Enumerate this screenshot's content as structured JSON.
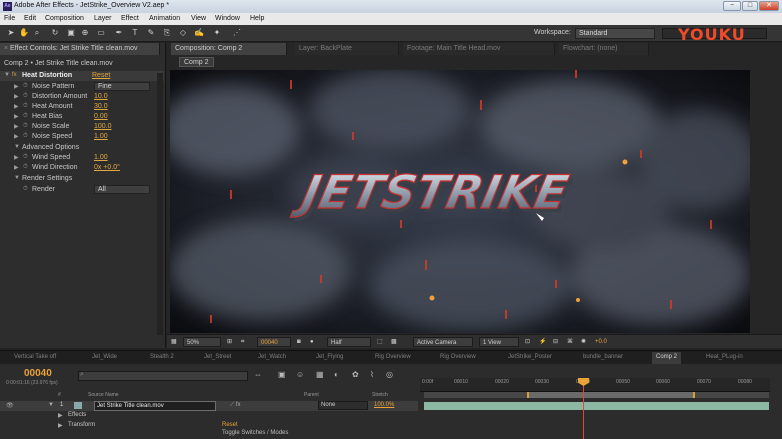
{
  "window": {
    "title": "Adobe After Effects - JetStrike_Overview V2.aep *",
    "app_icon": "Ae",
    "buttons": [
      "−",
      "□",
      "✕"
    ]
  },
  "menu": [
    "File",
    "Edit",
    "Composition",
    "Layer",
    "Effect",
    "Animation",
    "View",
    "Window",
    "Help"
  ],
  "toolbar": {
    "workspace_label": "Workspace:",
    "workspace_value": "Standard",
    "watermark": "YOUKU"
  },
  "effect_controls": {
    "tab_label": "Effect Controls: Jet Strike Title clean.mov",
    "breadcrumb": "Comp 2 • Jet Strike Title clean.mov",
    "effect_name": "Heat Distortion",
    "reset_label": "Reset",
    "properties": [
      {
        "label": "Noise Pattern",
        "value": "Fine",
        "kind": "dropdown"
      },
      {
        "label": "Distortion Amount",
        "value": "10.0",
        "kind": "value"
      },
      {
        "label": "Heat Amount",
        "value": "30.0",
        "kind": "value"
      },
      {
        "label": "Heat Bias",
        "value": "0.00",
        "kind": "value"
      },
      {
        "label": "Noise Scale",
        "value": "100.0",
        "kind": "value"
      },
      {
        "label": "Noise Speed",
        "value": "1.00",
        "kind": "value"
      },
      {
        "label": "Advanced Options",
        "value": "",
        "kind": "group"
      },
      {
        "label": "Wind Speed",
        "value": "1.00",
        "kind": "value"
      },
      {
        "label": "Wind Direction",
        "value": "0x +0.0°",
        "kind": "value"
      },
      {
        "label": "Render Settings",
        "value": "",
        "kind": "group"
      },
      {
        "label": "Render",
        "value": "All",
        "kind": "dropdown"
      }
    ]
  },
  "composition_panel": {
    "tabs": [
      {
        "label": "Composition: Comp 2",
        "active": true
      },
      {
        "label": "Layer: BackPlate",
        "active": false
      },
      {
        "label": "Footage: Main Title Head.mov",
        "active": false
      },
      {
        "label": "Flowchart: (none)",
        "active": false
      }
    ],
    "comp_button": "Comp 2",
    "title_text": "JETSTRIKE"
  },
  "viewer_bar": {
    "zoom": "50%",
    "timecode": "00040",
    "resolution": "Half",
    "camera": "Active Camera",
    "views": "1 View",
    "exposure": "+0.0"
  },
  "timeline_tabs": [
    {
      "label": "Vertical Take off",
      "active": false
    },
    {
      "label": "Jet_Wide",
      "active": false
    },
    {
      "label": "Stealth 2",
      "active": false
    },
    {
      "label": "Jet_Street",
      "active": false
    },
    {
      "label": "Jet_Watch",
      "active": false
    },
    {
      "label": "Jet_Flying",
      "active": false
    },
    {
      "label": "Rig Overview",
      "active": false
    },
    {
      "label": "Rig Overview",
      "active": false
    },
    {
      "label": "JetStrike_Poster",
      "active": false
    },
    {
      "label": "bundle_banner",
      "active": false
    },
    {
      "label": "Comp 2",
      "active": true
    },
    {
      "label": "Heat_PLug-in",
      "active": false
    }
  ],
  "timeline": {
    "timecode": "00040",
    "timecode_sub": "0:00:01:16 (23.976 fps)",
    "columns": [
      "#",
      "Source Name",
      "Parent",
      "Stretch"
    ],
    "layer": {
      "number": "1",
      "name": "Jet Strike Title clean.mov",
      "parent": "None",
      "stretch": "100.0%"
    },
    "sub_rows": [
      {
        "label": "Effects",
        "value": ""
      },
      {
        "label": "Transform",
        "value": "Reset"
      }
    ],
    "ruler_ticks": [
      "0:00f",
      "00010",
      "00020",
      "00030",
      "00040",
      "00050",
      "00060",
      "00070",
      "00080"
    ],
    "toggle_label": "Toggle Switches / Modes"
  }
}
